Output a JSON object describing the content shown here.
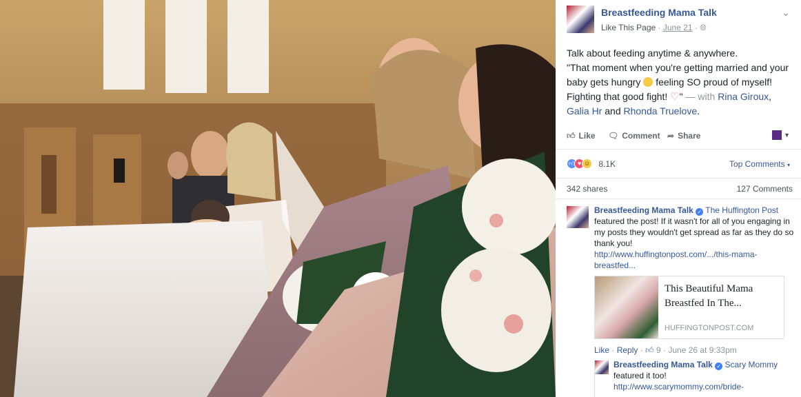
{
  "post": {
    "page_name": "Breastfeeding Mama Talk",
    "like_page": "Like This Page",
    "date": "June 21",
    "sep": "·",
    "privacy_icon": "globe-icon",
    "menu_icon": "chevron-down-icon",
    "text_line1": "Talk about feeding anytime & anywhere.",
    "text_part2": "\"That moment when you're getting married and your baby gets hungry",
    "text_part3": "feeling SO proud of myself! Fighting that good fight!",
    "text_part4": "\"",
    "with_label": "— with",
    "tagged_1": "Rina Giroux",
    "comma": ",",
    "tagged_2": "Galia Hr",
    "and_label": "and",
    "tagged_3": "Rhonda Truelove",
    "period": "."
  },
  "actions": {
    "like": "Like",
    "comment": "Comment",
    "share": "Share"
  },
  "stats": {
    "reaction_count": "8.1K",
    "top_comments": "Top Comments",
    "shares": "342 shares",
    "comments": "127 Comments"
  },
  "comment1": {
    "author": "Breastfeeding Mama Talk",
    "mention": "The Huffington Post",
    "text": "featured the post! If it wasn't for all of you engaging in my posts they wouldn't get spread as far as they do so thank you!",
    "link": "http://www.huffingtonpost.com/.../this-mama-breastfed...",
    "card_title": "This Beautiful Mama Breastfed In The...",
    "card_source": "HUFFINGTONPOST.COM",
    "like": "Like",
    "reply": "Reply",
    "like_count": "9",
    "timestamp": "June 26 at 9:33pm"
  },
  "reply1": {
    "author": "Breastfeeding Mama Talk",
    "mention": "Scary Mommy",
    "text": "featured it too!",
    "link": "http://www.scarymommy.com/bride-"
  },
  "colors": {
    "link": "#365899",
    "meta": "#90949c",
    "like_blue": "#5890ff",
    "love_red": "#f25268"
  }
}
